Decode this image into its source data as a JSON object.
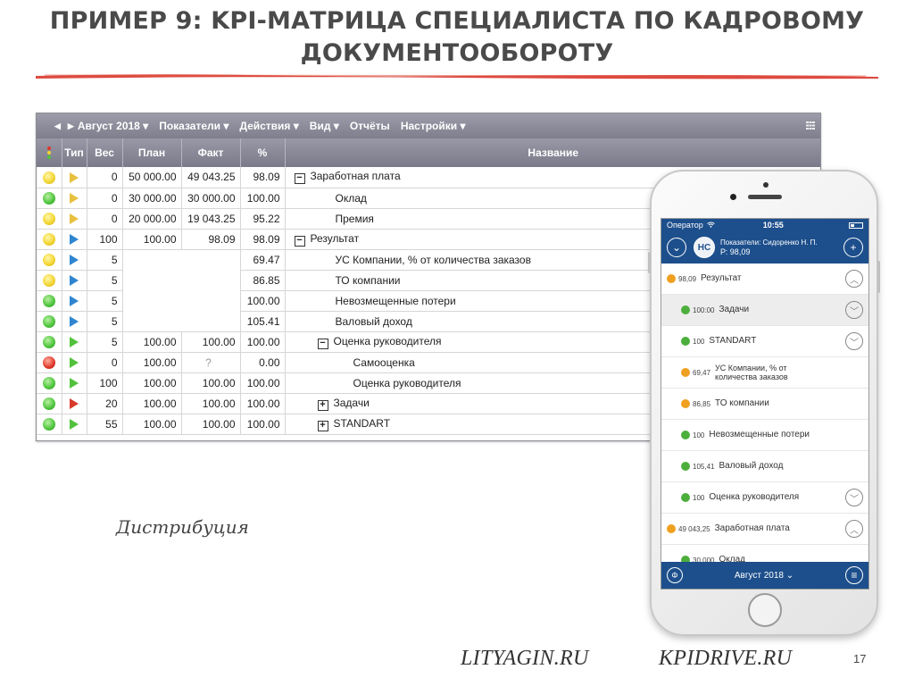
{
  "slide": {
    "title_line1": "ПРИМЕР 9: KPI-МАТРИЦА СПЕЦИАЛИСТА ПО КАДРОВОМУ",
    "title_line2": "ДОКУМЕНТООБОРОТУ",
    "brush_color": "#d9362b",
    "distribution_label": "Дистрибуция",
    "site1": "LITYAGIN.RU",
    "site2": "KPIDRIVE.RU",
    "page_number": "17"
  },
  "desktop": {
    "menu": {
      "prev_icon": "triangle-left-icon",
      "next_icon": "triangle-right-icon",
      "period": "Август 2018",
      "items": [
        "Показатели",
        "Действия",
        "Вид",
        "Отчёты",
        "Настройки"
      ],
      "items_with_dropdown": [
        true,
        true,
        true,
        false,
        true
      ]
    },
    "columns": [
      "",
      "Тип",
      "Вес",
      "План",
      "Факт",
      "%",
      "Название"
    ],
    "rows": [
      {
        "status": "yellow",
        "type": "yellow",
        "weight": "0",
        "plan": "50 000.00",
        "fact": "49 043.25",
        "percent": "98.09",
        "name": "Заработная плата",
        "toggle": "minus",
        "level": 0
      },
      {
        "status": "green",
        "type": "yellow",
        "weight": "0",
        "plan": "30 000.00",
        "fact": "30 000.00",
        "percent": "100.00",
        "name": "Оклад",
        "toggle": "",
        "level": 1
      },
      {
        "status": "yellow",
        "type": "yellow",
        "weight": "0",
        "plan": "20 000.00",
        "fact": "19 043.25",
        "percent": "95.22",
        "name": "Премия",
        "toggle": "",
        "level": 1
      },
      {
        "status": "yellow",
        "type": "blue",
        "weight": "100",
        "plan": "100.00",
        "fact": "98.09",
        "percent": "98.09",
        "name": "Результат",
        "toggle": "minus",
        "level": 0
      },
      {
        "status": "yellow",
        "type": "blue",
        "weight": "5",
        "plan": "",
        "fact": "",
        "percent": "69.47",
        "name": "УС Компании, % от количества заказов",
        "toggle": "",
        "level": 1
      },
      {
        "status": "yellow",
        "type": "blue",
        "weight": "5",
        "plan": "",
        "fact": "",
        "percent": "86.85",
        "name": "ТО компании",
        "toggle": "",
        "level": 1
      },
      {
        "status": "green",
        "type": "blue",
        "weight": "5",
        "plan": "",
        "fact": "",
        "percent": "100.00",
        "name": "Невозмещенные потери",
        "toggle": "",
        "level": 1
      },
      {
        "status": "green",
        "type": "blue",
        "weight": "5",
        "plan": "",
        "fact": "",
        "percent": "105.41",
        "name": "Валовый доход",
        "toggle": "",
        "level": 1
      },
      {
        "status": "green",
        "type": "green",
        "weight": "5",
        "plan": "100.00",
        "fact": "100.00",
        "percent": "100.00",
        "name": "Оценка руководителя",
        "toggle": "minus",
        "level": 2
      },
      {
        "status": "red",
        "type": "green",
        "weight": "0",
        "plan": "100.00",
        "fact": "?",
        "percent": "0.00",
        "name": "Самооценка",
        "toggle": "",
        "level": 3
      },
      {
        "status": "green",
        "type": "green",
        "weight": "100",
        "plan": "100.00",
        "fact": "100.00",
        "percent": "100.00",
        "name": "Оценка руководителя",
        "toggle": "",
        "level": 3
      },
      {
        "status": "green",
        "type": "red",
        "weight": "20",
        "plan": "100.00",
        "fact": "100.00",
        "percent": "100.00",
        "name": "Задачи",
        "toggle": "plus",
        "level": 2
      },
      {
        "status": "green",
        "type": "green",
        "weight": "55",
        "plan": "100.00",
        "fact": "100.00",
        "percent": "100.00",
        "name": "STANDART",
        "toggle": "plus",
        "level": 2
      }
    ]
  },
  "phone": {
    "status_bar": {
      "carrier": "Оператор",
      "time": "10:55"
    },
    "app_bar": {
      "avatar_initials": "НС",
      "line1": "Показатели: Сидоренко Н. П.",
      "line2": "Р: 98,09"
    },
    "items": [
      {
        "dot": "orange",
        "value": "98,09",
        "name": "Результат",
        "chevron": "up",
        "level": 0,
        "shaded": false
      },
      {
        "dot": "green",
        "value": "100:00",
        "name": "Задачи",
        "chevron": "down",
        "level": 1,
        "shaded": true
      },
      {
        "dot": "green",
        "value": "100",
        "name": "STANDART",
        "chevron": "down",
        "level": 1,
        "shaded": false
      },
      {
        "dot": "orange",
        "value": "69,47",
        "name": "УС Компании, % от количества заказов",
        "chevron": "",
        "level": 1,
        "shaded": false
      },
      {
        "dot": "orange",
        "value": "86,85",
        "name": "ТО компании",
        "chevron": "",
        "level": 1,
        "shaded": false
      },
      {
        "dot": "green",
        "value": "100",
        "name": "Невозмещенные потери",
        "chevron": "",
        "level": 1,
        "shaded": false
      },
      {
        "dot": "green",
        "value": "105,41",
        "name": "Валовый доход",
        "chevron": "",
        "level": 1,
        "shaded": false
      },
      {
        "dot": "green",
        "value": "100",
        "name": "Оценка руководителя",
        "chevron": "down",
        "level": 1,
        "shaded": false
      },
      {
        "dot": "orange",
        "value": "49 043,25",
        "name": "Заработная плата",
        "chevron": "up",
        "level": 0,
        "shaded": false
      },
      {
        "dot": "green",
        "value": "30 000",
        "name": "Оклад",
        "chevron": "",
        "level": 1,
        "shaded": false
      }
    ],
    "bottom_bar": {
      "period": "Август 2018"
    }
  }
}
